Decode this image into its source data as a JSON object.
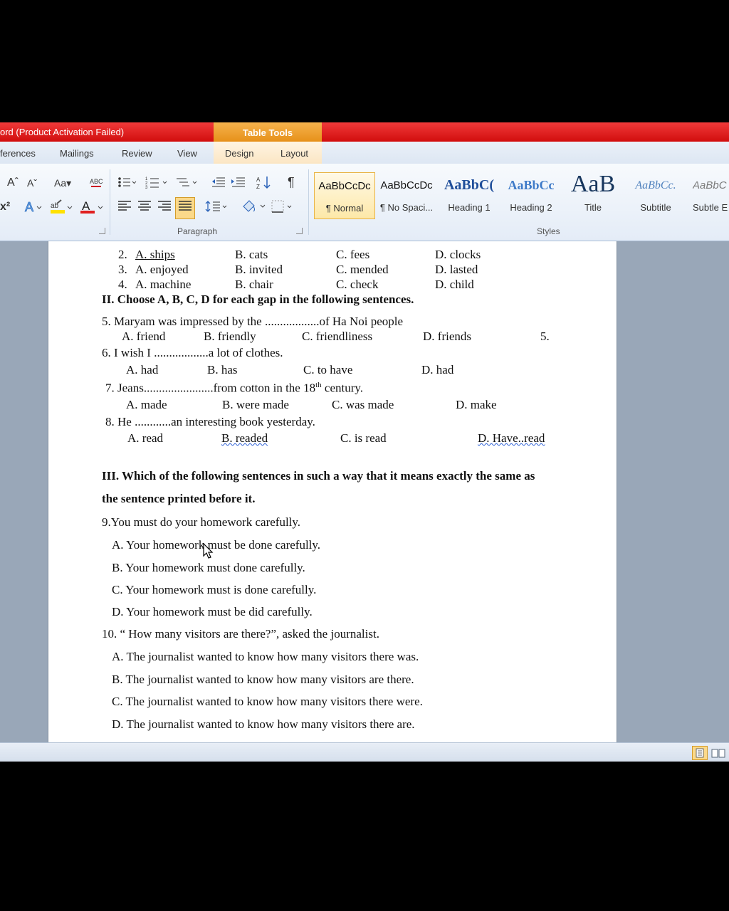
{
  "window": {
    "title": "ord (Product Activation Failed)",
    "contextual_tab": "Table Tools"
  },
  "tabs": [
    "ferences",
    "Mailings",
    "Review",
    "View",
    "Design",
    "Layout"
  ],
  "ribbon": {
    "font_grow": "Aˆ",
    "font_shrink": "Aˇ",
    "change_case": "Aa▾",
    "superscript": "x²",
    "pilcrow": "¶",
    "paragraph_label": "Paragraph",
    "styles_label": "Styles",
    "styles": [
      {
        "sample": "AaBbCcDc",
        "name": "¶ Normal"
      },
      {
        "sample": "AaBbCcDc",
        "name": "¶ No Spaci..."
      },
      {
        "sample": "AaBbC(",
        "name": "Heading 1"
      },
      {
        "sample": "AaBbCc",
        "name": "Heading 2"
      },
      {
        "sample": "AaB",
        "name": "Title"
      },
      {
        "sample": "AaBbCc.",
        "name": "Subtitle"
      },
      {
        "sample": "AaBbC",
        "name": "Subtle E"
      }
    ],
    "colors": {
      "accent": "#1f4e9a",
      "font_red": "#e02020",
      "highlight": "#ffe100"
    }
  },
  "document": {
    "q2": {
      "num": "2.",
      "a": "A. ships",
      "b": "B. cats",
      "c": "C. fees",
      "d": "D. clocks"
    },
    "q3": {
      "num": "3.",
      "a": "A. enjoyed",
      "b": "B. invited",
      "c": "C. mended",
      "d": "D. lasted"
    },
    "q4": {
      "num": "4.",
      "a": "A. machine",
      "b": "B. chair",
      "c": "C. check",
      "d": "D. child"
    },
    "section2": "II. Choose A, B, C, D for each gap in the following sentences.",
    "q5": {
      "stem": "5. Maryam was impressed by the ..................of  Ha Noi people",
      "a": "A. friend",
      "b": "B. friendly",
      "c": "C. friendliness",
      "d": "D. friends",
      "margin": "5."
    },
    "q6": {
      "stem": "6. I wish I ..................a lot of clothes.",
      "a": "A. had",
      "b": "B. has",
      "c": "C. to have",
      "d": "D. had"
    },
    "q7": {
      "stem_pre": "7. Jeans.......................from cotton in the 18",
      "sup": "th",
      "stem_post": " century.",
      "a": "A. made",
      "b": "B. were made",
      "c": "C. was made",
      "d": "D. make"
    },
    "q8": {
      "stem": "8. He ............an interesting book yesterday.",
      "a": "A. read",
      "b": "B. readed",
      "c": "C. is read",
      "d": "D. Have..read"
    },
    "section3_line1": "III. Which of the following sentences in such a way that it means exactly the same as",
    "section3_line2": "the sentence printed before it.",
    "q9": {
      "stem": "9.You must do your homework carefully.",
      "a": "A. Your homework must be done carefully.",
      "b": "B. Your homework must done carefully.",
      "c": "C. Your homework must is done carefully.",
      "d": "D. Your homework must be did carefully."
    },
    "q10": {
      "stem": "10. “ How many visitors are there?”, asked the journalist.",
      "a": "A. The journalist wanted to know how many visitors there was.",
      "b": "B. The journalist wanted to know how many visitors are there.",
      "c": "C. The journalist wanted to know how many visitors there were.",
      "d": "D. The journalist wanted to know how many visitors there are."
    }
  }
}
